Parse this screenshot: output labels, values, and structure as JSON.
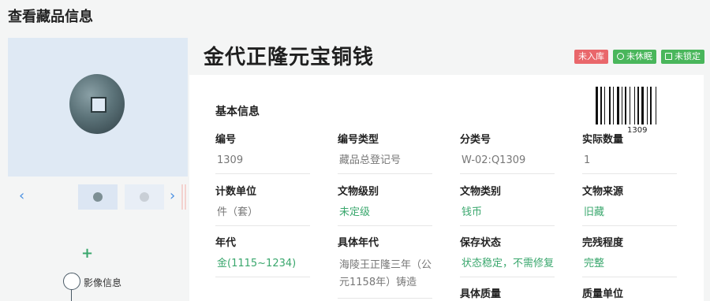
{
  "page": {
    "title": "查看藏品信息"
  },
  "item": {
    "title": "金代正隆元宝铜钱",
    "badges": [
      {
        "label": "未入库",
        "color": "#e9676b"
      },
      {
        "label": "未休眠",
        "color": "#49b65b",
        "icon": "clock-icon"
      },
      {
        "label": "未锁定",
        "color": "#49b65b",
        "icon": "lock-icon"
      }
    ],
    "barcode_number": "1309"
  },
  "gallery": {
    "thumbnails": [
      "coin-thumb-1",
      "coin-thumb-2"
    ]
  },
  "sidebar": {
    "timeline_label": "影像信息"
  },
  "section": {
    "title": "基本信息"
  },
  "fields": [
    {
      "label": "编号",
      "value": "1309"
    },
    {
      "label": "编号类型",
      "value": "藏品总登记号"
    },
    {
      "label": "分类号",
      "value": "W-02:Q1309"
    },
    {
      "label": "实际数量",
      "value": "1"
    },
    {
      "label": "计数单位",
      "value": "件（套）"
    },
    {
      "label": "文物级别",
      "value": "未定级"
    },
    {
      "label": "文物类别",
      "value": "钱币"
    },
    {
      "label": "文物来源",
      "value": "旧藏"
    },
    {
      "label": "年代",
      "value": "金(1115~1234)"
    },
    {
      "label": "具体年代",
      "value": "海陵王正隆三年（公元1158年）铸造"
    },
    {
      "label": "保存状态",
      "value": "状态稳定，不需修复"
    },
    {
      "label": "完残程度",
      "value": "完整"
    },
    {
      "label": "具体质量",
      "value": ""
    },
    {
      "label": "质量单位",
      "value": ""
    }
  ]
}
